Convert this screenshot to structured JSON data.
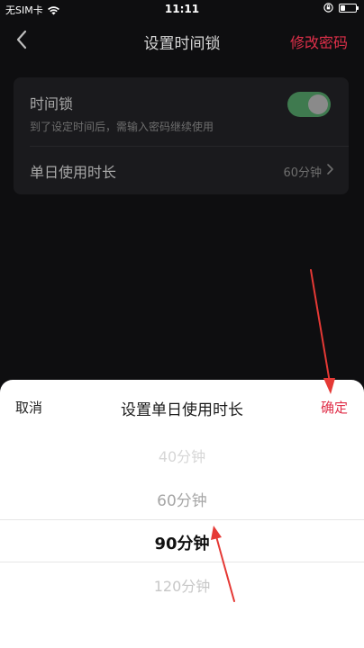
{
  "status_bar": {
    "carrier": "无SIM卡",
    "time": "11:11",
    "battery_level": 0.3
  },
  "nav": {
    "back_icon": "chevron-left-icon",
    "title": "设置时间锁",
    "action": "修改密码"
  },
  "settings": {
    "time_lock": {
      "label": "时间锁",
      "description": "到了设定时间后，需输入密码继续使用",
      "enabled": true
    },
    "daily_duration": {
      "label": "单日使用时长",
      "value": "60分钟",
      "chevron_icon": "chevron-right-icon"
    }
  },
  "sheet": {
    "cancel": "取消",
    "title": "设置单日使用时长",
    "confirm": "确定",
    "options": [
      "40分钟",
      "60分钟",
      "90分钟",
      "120分钟"
    ],
    "selected": "90分钟"
  },
  "colors": {
    "accent": "#e0304a",
    "toggle_on": "#3f7a4f",
    "background": "#0e0e10",
    "card": "#1a1a1d",
    "annotation_arrow": "#e53935"
  }
}
